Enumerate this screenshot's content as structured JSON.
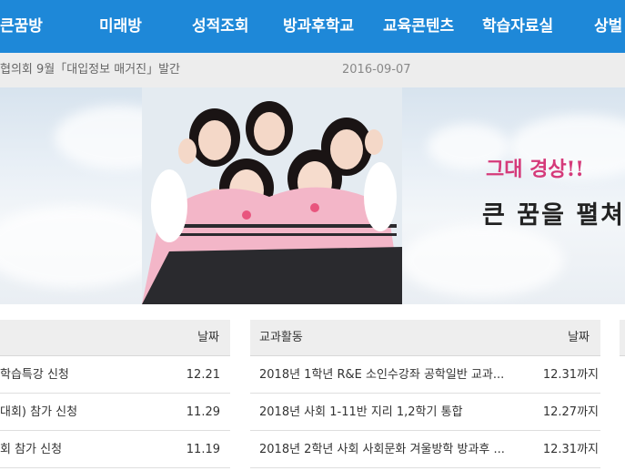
{
  "nav": {
    "items": [
      "큰꿈방",
      "미래방",
      "성적조회",
      "방과후학교",
      "교육콘텐츠",
      "학습자료실",
      "상벌"
    ]
  },
  "ticker": {
    "text": "협의회 9월「대입정보 매거진」발간",
    "date": "2016-09-07"
  },
  "banner": {
    "slogan_line1": "그대 경상!!",
    "slogan_line2": "큰 꿈을 펼쳐"
  },
  "boards": {
    "left": {
      "date_header": "날짜",
      "rows": [
        {
          "title": "학습특강 신청",
          "date": "12.21"
        },
        {
          "title": "대회) 참가 신청",
          "date": "11.29"
        },
        {
          "title": "회 참가 신청",
          "date": "11.19"
        }
      ]
    },
    "middle": {
      "title": "교과활동",
      "date_header": "날짜",
      "rows": [
        {
          "title": "2018년 1학년 R&E 소인수강좌 공학일반 교과...",
          "date": "12.31까지"
        },
        {
          "title": "2018년 사회 1-11반 지리 1,2학기 통합",
          "date": "12.27까지"
        },
        {
          "title": "2018년 2학년 사회 사회문화 겨울방학 방과후 ...",
          "date": "12.31까지"
        }
      ]
    }
  },
  "colors": {
    "nav_bg": "#1e88d8",
    "ticker_bg": "#ededed",
    "slogan_accent": "#d53a7a"
  }
}
